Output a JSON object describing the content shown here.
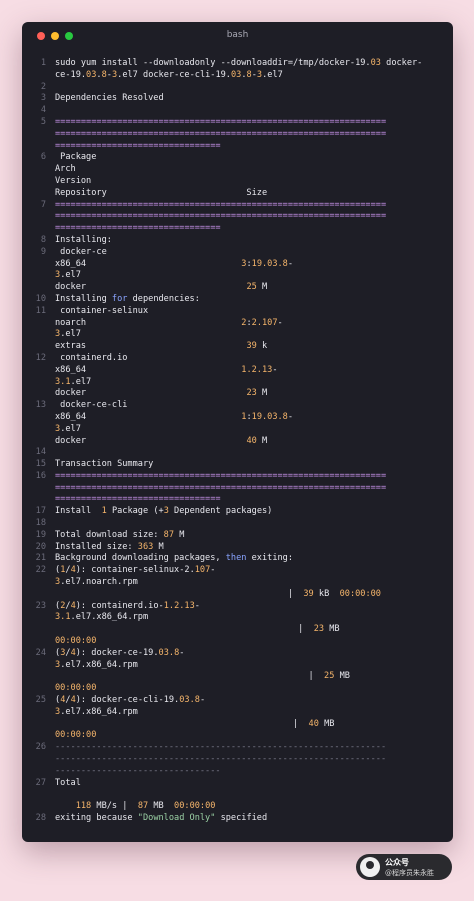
{
  "window": {
    "title": "bash",
    "colors": {
      "background": "#1e1e26",
      "text": "#e8e8ee",
      "separator": "#c792ea",
      "highlight_number": "#f5b56b",
      "keyword": "#8aa4ff"
    }
  },
  "terminal": {
    "rows": [
      {
        "num": "1",
        "segs": [
          {
            "t": "sudo yum install --downloadonly --downloaddir=/tmp/docker-19."
          },
          {
            "t": "03",
            "c": "hl"
          },
          {
            "t": " docker-"
          }
        ]
      },
      {
        "num": "",
        "segs": [
          {
            "t": "ce-19."
          },
          {
            "t": "03",
            "c": "hl"
          },
          {
            "t": "."
          },
          {
            "t": "8",
            "c": "hl"
          },
          {
            "t": "-"
          },
          {
            "t": "3",
            "c": "hl"
          },
          {
            "t": ".el7 docker-ce-cli-19."
          },
          {
            "t": "03",
            "c": "hl"
          },
          {
            "t": "."
          },
          {
            "t": "8",
            "c": "hl"
          },
          {
            "t": "-"
          },
          {
            "t": "3",
            "c": "hl"
          },
          {
            "t": ".el7"
          }
        ]
      },
      {
        "num": "2",
        "segs": []
      },
      {
        "num": "3",
        "segs": [
          {
            "t": "Dependencies Resolved"
          }
        ]
      },
      {
        "num": "4",
        "segs": []
      },
      {
        "num": "5",
        "segs": [
          {
            "t": "================================================================",
            "c": "sep"
          }
        ]
      },
      {
        "num": "",
        "segs": [
          {
            "t": "================================================================",
            "c": "sep"
          }
        ]
      },
      {
        "num": "",
        "segs": [
          {
            "t": "================================",
            "c": "sep"
          }
        ]
      },
      {
        "num": "6",
        "segs": [
          {
            "t": " Package"
          }
        ]
      },
      {
        "num": "",
        "segs": [
          {
            "t": "Arch"
          }
        ]
      },
      {
        "num": "",
        "segs": [
          {
            "t": "Version"
          }
        ]
      },
      {
        "num": "",
        "segs": [
          {
            "t": "Repository                           Size"
          }
        ]
      },
      {
        "num": "7",
        "segs": [
          {
            "t": "================================================================",
            "c": "sep"
          }
        ]
      },
      {
        "num": "",
        "segs": [
          {
            "t": "================================================================",
            "c": "sep"
          }
        ]
      },
      {
        "num": "",
        "segs": [
          {
            "t": "================================",
            "c": "sep"
          }
        ]
      },
      {
        "num": "8",
        "segs": [
          {
            "t": "Installing:"
          }
        ]
      },
      {
        "num": "9",
        "segs": [
          {
            "t": " docker-ce"
          }
        ]
      },
      {
        "num": "",
        "segs": [
          {
            "t": "x86_64                              "
          },
          {
            "t": "3",
            "c": "hl"
          },
          {
            "t": ":"
          },
          {
            "t": "19.03.8",
            "c": "hl"
          },
          {
            "t": "-"
          }
        ]
      },
      {
        "num": "",
        "segs": [
          {
            "t": "3",
            "c": "hl"
          },
          {
            "t": ".el7"
          }
        ]
      },
      {
        "num": "",
        "segs": [
          {
            "t": "docker                               "
          },
          {
            "t": "25",
            "c": "hl"
          },
          {
            "t": " M"
          }
        ]
      },
      {
        "num": "10",
        "segs": [
          {
            "t": "Installing "
          },
          {
            "t": "for",
            "c": "kw"
          },
          {
            "t": " dependencies:"
          }
        ]
      },
      {
        "num": "11",
        "segs": [
          {
            "t": " container-selinux"
          }
        ]
      },
      {
        "num": "",
        "segs": [
          {
            "t": "noarch                              "
          },
          {
            "t": "2",
            "c": "hl"
          },
          {
            "t": ":"
          },
          {
            "t": "2.107",
            "c": "hl"
          },
          {
            "t": "-"
          }
        ]
      },
      {
        "num": "",
        "segs": [
          {
            "t": "3",
            "c": "hl"
          },
          {
            "t": ".el7"
          }
        ]
      },
      {
        "num": "",
        "segs": [
          {
            "t": "extras                               "
          },
          {
            "t": "39",
            "c": "hl"
          },
          {
            "t": " k"
          }
        ]
      },
      {
        "num": "12",
        "segs": [
          {
            "t": " containerd.io"
          }
        ]
      },
      {
        "num": "",
        "segs": [
          {
            "t": "x86_64                              "
          },
          {
            "t": "1.2.13",
            "c": "hl"
          },
          {
            "t": "-"
          }
        ]
      },
      {
        "num": "",
        "segs": [
          {
            "t": "3.1",
            "c": "hl"
          },
          {
            "t": ".el7"
          }
        ]
      },
      {
        "num": "",
        "segs": [
          {
            "t": "docker                               "
          },
          {
            "t": "23",
            "c": "hl"
          },
          {
            "t": " M"
          }
        ]
      },
      {
        "num": "13",
        "segs": [
          {
            "t": " docker-ce-cli"
          }
        ]
      },
      {
        "num": "",
        "segs": [
          {
            "t": "x86_64                              "
          },
          {
            "t": "1",
            "c": "hl"
          },
          {
            "t": ":"
          },
          {
            "t": "19.03.8",
            "c": "hl"
          },
          {
            "t": "-"
          }
        ]
      },
      {
        "num": "",
        "segs": [
          {
            "t": "3",
            "c": "hl"
          },
          {
            "t": ".el7"
          }
        ]
      },
      {
        "num": "",
        "segs": [
          {
            "t": "docker                               "
          },
          {
            "t": "40",
            "c": "hl"
          },
          {
            "t": " M"
          }
        ]
      },
      {
        "num": "14",
        "segs": []
      },
      {
        "num": "15",
        "segs": [
          {
            "t": "Transaction Summary"
          }
        ]
      },
      {
        "num": "16",
        "segs": [
          {
            "t": "================================================================",
            "c": "sep"
          }
        ]
      },
      {
        "num": "",
        "segs": [
          {
            "t": "================================================================",
            "c": "sep"
          }
        ]
      },
      {
        "num": "",
        "segs": [
          {
            "t": "================================",
            "c": "sep"
          }
        ]
      },
      {
        "num": "17",
        "segs": [
          {
            "t": "Install  "
          },
          {
            "t": "1",
            "c": "hl"
          },
          {
            "t": " Package (+"
          },
          {
            "t": "3",
            "c": "hl"
          },
          {
            "t": " Dependent packages)"
          }
        ]
      },
      {
        "num": "18",
        "segs": []
      },
      {
        "num": "19",
        "segs": [
          {
            "t": "Total download size: "
          },
          {
            "t": "87",
            "c": "hl"
          },
          {
            "t": " M"
          }
        ]
      },
      {
        "num": "20",
        "segs": [
          {
            "t": "Installed size: "
          },
          {
            "t": "363",
            "c": "hl"
          },
          {
            "t": " M"
          }
        ]
      },
      {
        "num": "21",
        "segs": [
          {
            "t": "Background downloading packages, "
          },
          {
            "t": "then",
            "c": "kw"
          },
          {
            "t": " exiting:"
          }
        ]
      },
      {
        "num": "22",
        "segs": [
          {
            "t": "("
          },
          {
            "t": "1",
            "c": "hl"
          },
          {
            "t": "/"
          },
          {
            "t": "4",
            "c": "hl"
          },
          {
            "t": "): container-selinux-2."
          },
          {
            "t": "107",
            "c": "hl"
          },
          {
            "t": "-"
          }
        ]
      },
      {
        "num": "",
        "segs": [
          {
            "t": "3",
            "c": "hl"
          },
          {
            "t": ".el7.noarch.rpm"
          }
        ]
      },
      {
        "num": "",
        "segs": [
          {
            "t": "                                             |  "
          },
          {
            "t": "39",
            "c": "hl"
          },
          {
            "t": " kB  "
          },
          {
            "t": "00:00:00",
            "c": "hl"
          }
        ]
      },
      {
        "num": "23",
        "segs": [
          {
            "t": "("
          },
          {
            "t": "2",
            "c": "hl"
          },
          {
            "t": "/"
          },
          {
            "t": "4",
            "c": "hl"
          },
          {
            "t": "): containerd.io-"
          },
          {
            "t": "1.2.13",
            "c": "hl"
          },
          {
            "t": "-"
          }
        ]
      },
      {
        "num": "",
        "segs": [
          {
            "t": "3.1",
            "c": "hl"
          },
          {
            "t": ".el7.x86_64.rpm"
          }
        ]
      },
      {
        "num": "",
        "segs": [
          {
            "t": "                                               |  "
          },
          {
            "t": "23",
            "c": "hl"
          },
          {
            "t": " MB"
          }
        ]
      },
      {
        "num": "",
        "segs": [
          {
            "t": "00:00:00",
            "c": "hl"
          }
        ]
      },
      {
        "num": "24",
        "segs": [
          {
            "t": "("
          },
          {
            "t": "3",
            "c": "hl"
          },
          {
            "t": "/"
          },
          {
            "t": "4",
            "c": "hl"
          },
          {
            "t": "): docker-ce-19."
          },
          {
            "t": "03.8",
            "c": "hl"
          },
          {
            "t": "-"
          }
        ]
      },
      {
        "num": "",
        "segs": [
          {
            "t": "3",
            "c": "hl"
          },
          {
            "t": ".el7.x86_64.rpm"
          }
        ]
      },
      {
        "num": "",
        "segs": [
          {
            "t": "                                                 |  "
          },
          {
            "t": "25",
            "c": "hl"
          },
          {
            "t": " MB"
          }
        ]
      },
      {
        "num": "",
        "segs": [
          {
            "t": "00:00:00",
            "c": "hl"
          }
        ]
      },
      {
        "num": "25",
        "segs": [
          {
            "t": "("
          },
          {
            "t": "4",
            "c": "hl"
          },
          {
            "t": "/"
          },
          {
            "t": "4",
            "c": "hl"
          },
          {
            "t": "): docker-ce-cli-19."
          },
          {
            "t": "03.8",
            "c": "hl"
          },
          {
            "t": "-"
          }
        ]
      },
      {
        "num": "",
        "segs": [
          {
            "t": "3",
            "c": "hl"
          },
          {
            "t": ".el7.x86_64.rpm"
          }
        ]
      },
      {
        "num": "",
        "segs": [
          {
            "t": "                                              |  "
          },
          {
            "t": "40",
            "c": "hl"
          },
          {
            "t": " MB"
          }
        ]
      },
      {
        "num": "",
        "segs": [
          {
            "t": "00:00:00",
            "c": "hl"
          }
        ]
      },
      {
        "num": "26",
        "segs": [
          {
            "t": "----------------------------------------------------------------",
            "c": "dsep"
          }
        ]
      },
      {
        "num": "",
        "segs": [
          {
            "t": "----------------------------------------------------------------",
            "c": "dsep"
          }
        ]
      },
      {
        "num": "",
        "segs": [
          {
            "t": "--------------------------------",
            "c": "dsep"
          }
        ]
      },
      {
        "num": "27",
        "segs": [
          {
            "t": "Total"
          }
        ]
      },
      {
        "num": "",
        "segs": []
      },
      {
        "num": "",
        "segs": [
          {
            "t": "    "
          },
          {
            "t": "118",
            "c": "hl"
          },
          {
            "t": " MB/s |  "
          },
          {
            "t": "87",
            "c": "hl"
          },
          {
            "t": " MB  "
          },
          {
            "t": "00:00:00",
            "c": "hl"
          }
        ]
      },
      {
        "num": "28",
        "segs": [
          {
            "t": "exiting because "
          },
          {
            "t": "\"Download Only\"",
            "c": "str"
          },
          {
            "t": " specified"
          }
        ]
      }
    ]
  },
  "watermark": {
    "title": "公众号",
    "subtitle": "@程序员朱永胜"
  }
}
